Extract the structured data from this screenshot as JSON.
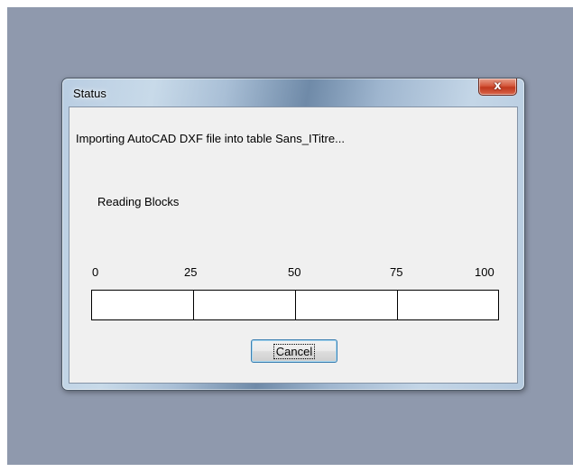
{
  "window": {
    "title": "Status",
    "close_glyph": "x",
    "close_icon": "close-icon"
  },
  "content": {
    "message": "Importing AutoCAD DXF file into table Sans_ITitre...",
    "phase": "Reading Blocks"
  },
  "progress": {
    "value_percent": 0,
    "ticks": [
      "0",
      "25",
      "50",
      "75",
      "100"
    ]
  },
  "buttons": {
    "cancel_label": "Cancel"
  },
  "colors": {
    "desktop": "#8f99ad",
    "close_button": "#c0381d",
    "button_focus_border": "#3c7fb1"
  }
}
